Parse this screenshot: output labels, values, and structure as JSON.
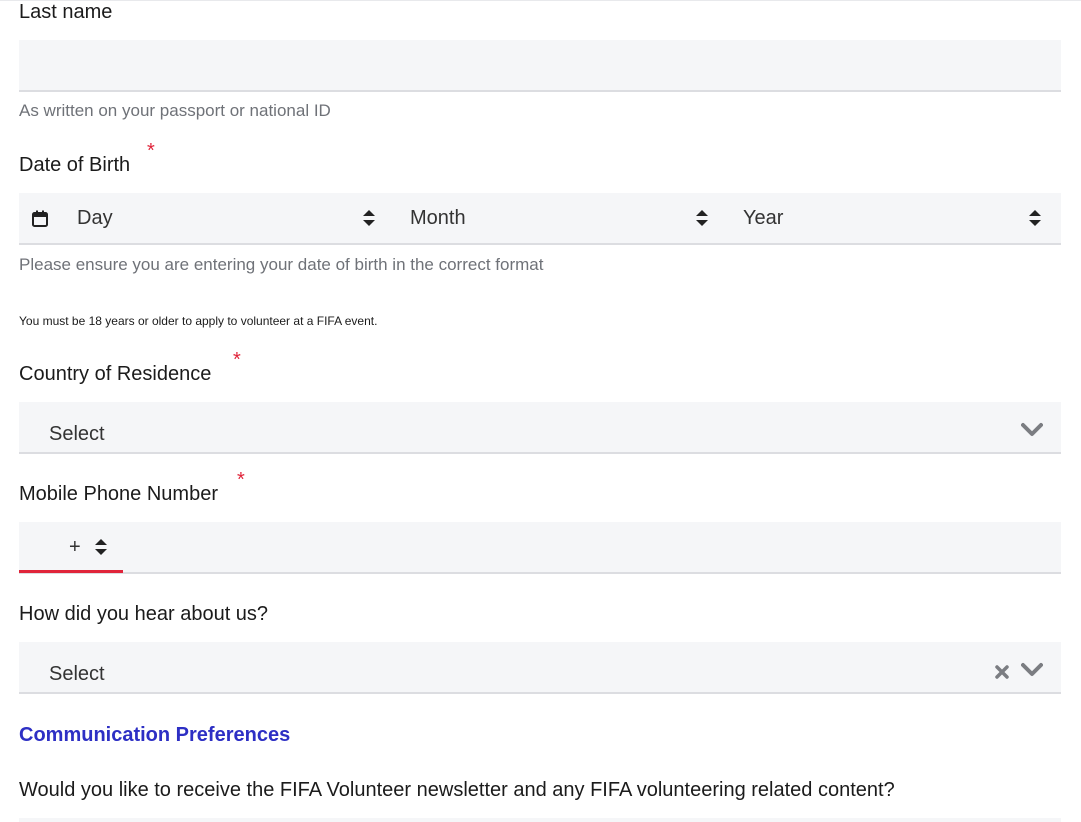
{
  "last_name": {
    "label": "Last name",
    "value": "",
    "help": "As written on your passport or national ID"
  },
  "dob": {
    "label": "Date of Birth",
    "required_mark": "*",
    "day_placeholder": "Day",
    "month_placeholder": "Month",
    "year_placeholder": "Year",
    "help": "Please ensure you are entering your date of birth in the correct format",
    "note": "You must be 18 years or older to apply to volunteer at a FIFA event."
  },
  "country": {
    "label": "Country of Residence",
    "required_mark": "*",
    "selected": "Select"
  },
  "phone": {
    "label": "Mobile Phone Number",
    "required_mark": "*",
    "prefix": "+",
    "value": ""
  },
  "hear_about": {
    "label": "How did you hear about us?",
    "selected": "Select"
  },
  "communication": {
    "title": "Communication Preferences",
    "question": "Would you like to receive the FIFA Volunteer newsletter and any FIFA volunteering related content?"
  },
  "colors": {
    "accent": "#2d2fc4",
    "required": "#e0243a",
    "field_bg": "#f5f6f8"
  }
}
